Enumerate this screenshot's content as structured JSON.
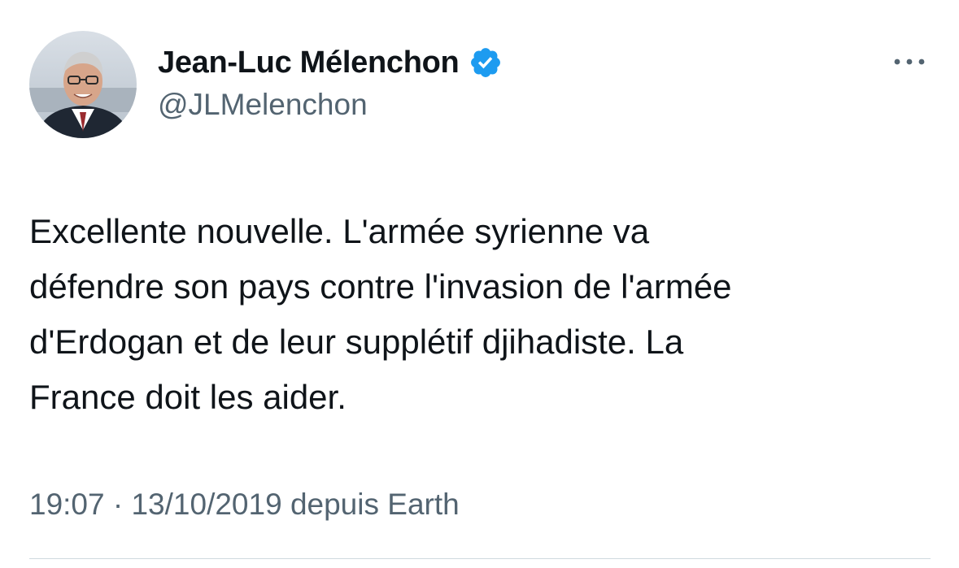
{
  "author": {
    "display_name": "Jean-Luc Mélenchon",
    "handle": "@JLMelenchon",
    "verified": true,
    "avatar_icon": "profile-photo",
    "verified_icon": "verified-badge-icon",
    "verified_color": "#1d9bf0"
  },
  "more_icon": "more-options-icon",
  "tweet": {
    "text": "Excellente nouvelle. L'armée syrienne va\ndéfendre son pays contre l'invasion de l'armée\nd'Erdogan et de leur supplétif djihadiste. La\nFrance doit les aider."
  },
  "meta": {
    "time": "19:07",
    "separator": " · ",
    "date": "13/10/2019",
    "source": " depuis Earth"
  },
  "colors": {
    "text_primary": "#0f1419",
    "text_secondary": "#536471",
    "divider": "#cfd9de"
  }
}
